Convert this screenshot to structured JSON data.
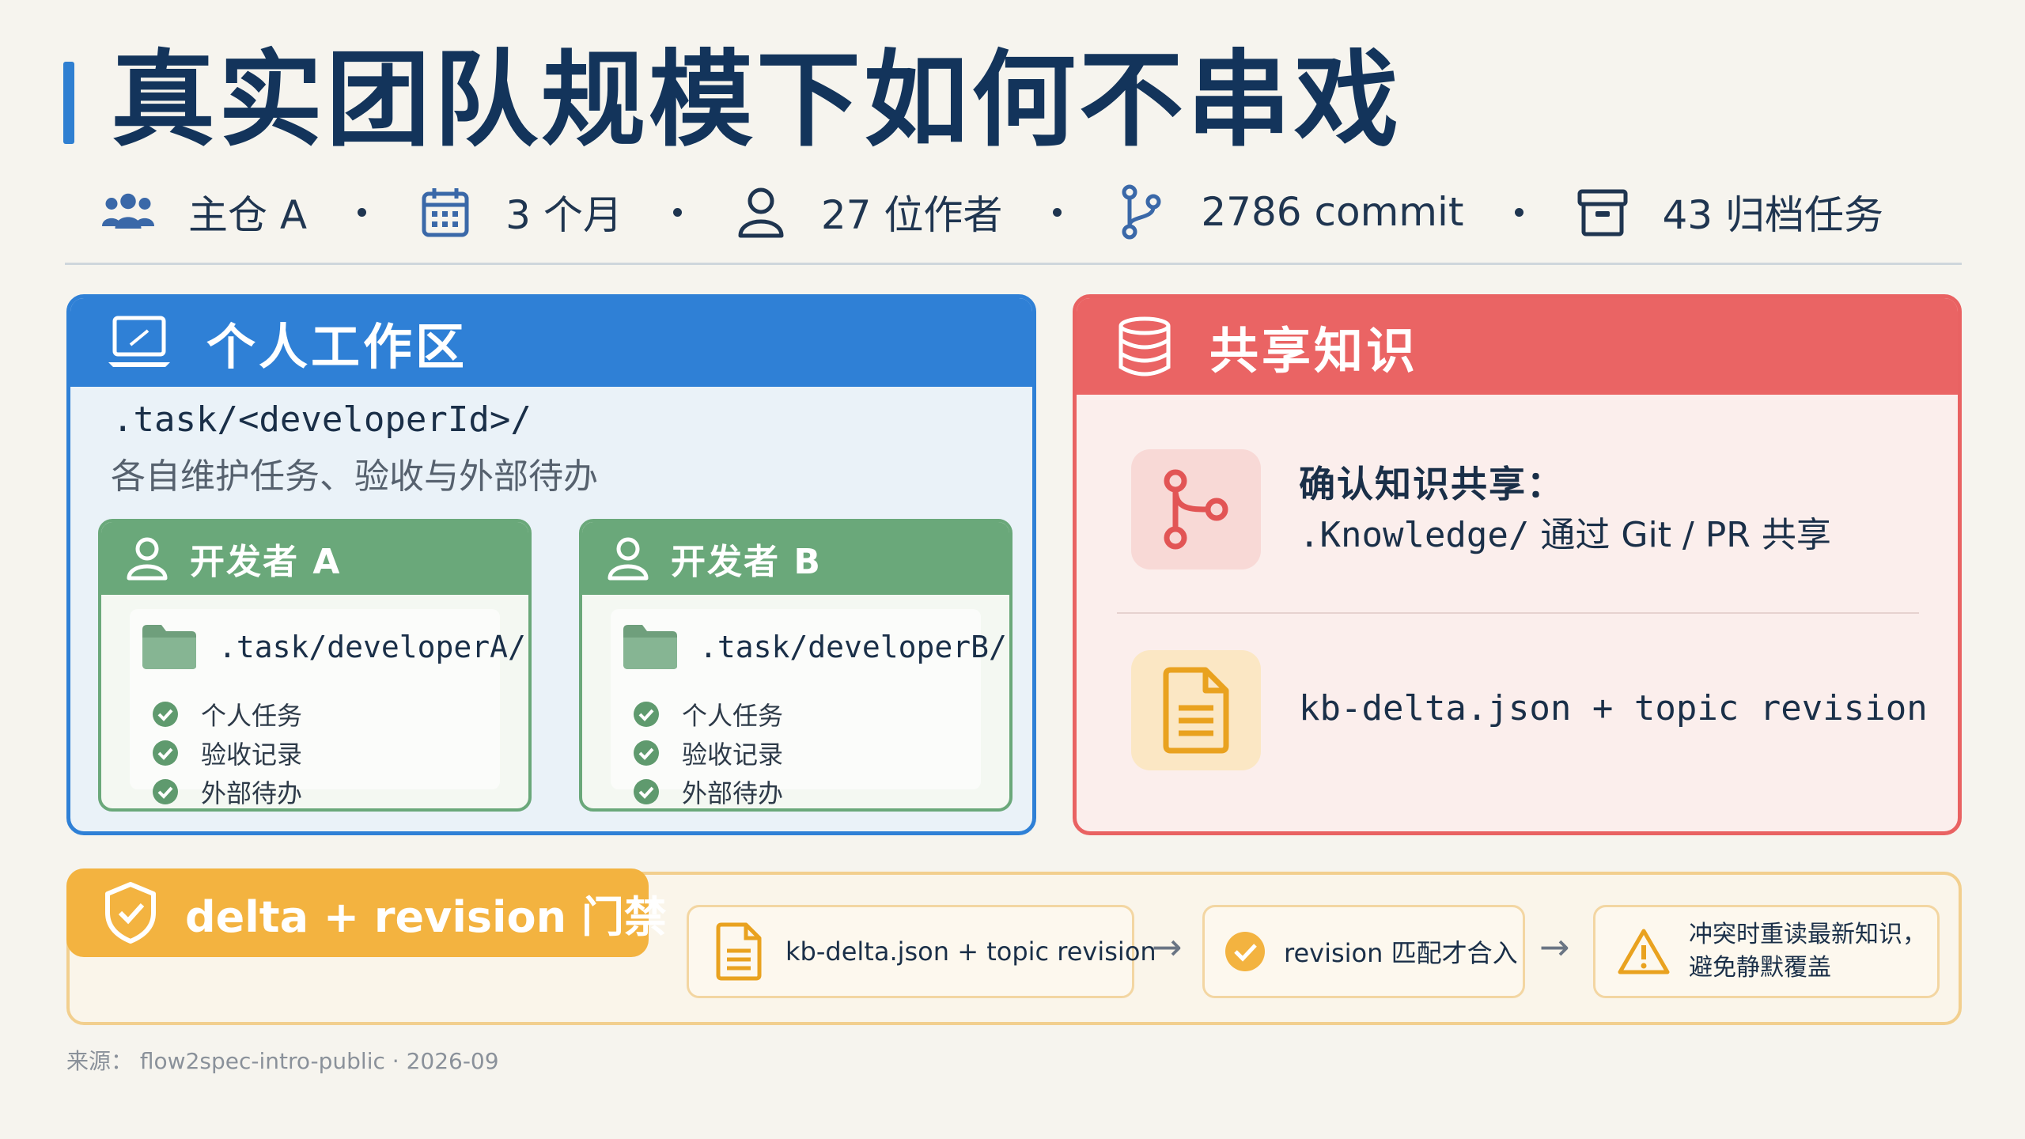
{
  "title": "真实团队规模下如何不串戏",
  "stats": [
    {
      "icon": "users-icon",
      "text": "主仓 A"
    },
    {
      "icon": "calendar-icon",
      "text": "3 个月"
    },
    {
      "icon": "user-icon",
      "text": "27 位作者"
    },
    {
      "icon": "git-branch-icon",
      "text": "2786 commit"
    },
    {
      "icon": "archive-icon",
      "text": "43 归档任务"
    }
  ],
  "personal": {
    "title": "个人工作区",
    "path": ".task/<developerId>/",
    "desc": "各自维护任务、验收与外部待办",
    "developers": [
      {
        "name": "开发者 A",
        "path": ".task/developerA/",
        "items": [
          "个人任务",
          "验收记录",
          "外部待办"
        ]
      },
      {
        "name": "开发者 B",
        "path": ".task/developerB/",
        "items": [
          "个人任务",
          "验收记录",
          "外部待办"
        ]
      }
    ]
  },
  "shared": {
    "title": "共享知识",
    "row1_title": "确认知识共享：",
    "row1_path": ".Knowledge/",
    "row1_rest": " 通过 Git / PR 共享",
    "row2_text": "kb-delta.json + topic revision"
  },
  "gate": {
    "label": "delta + revision 门禁",
    "step1": "kb-delta.json + topic revision",
    "step2": "revision 匹配才合入",
    "step3_line1": "冲突时重读最新知识，",
    "step3_line2": "避免静默覆盖",
    "arrow": "→"
  },
  "source": "来源： flow2spec-intro-public · 2026-09",
  "colors": {
    "title": "#13345b",
    "blue": "#2f80d6",
    "red": "#ea6464",
    "green": "#6aa87a",
    "yellow": "#f3b340"
  }
}
